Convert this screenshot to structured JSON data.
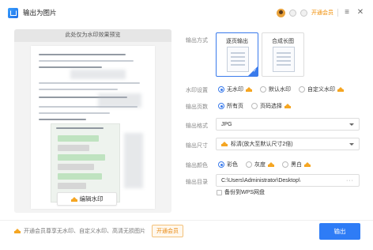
{
  "window": {
    "title": "输出为图片",
    "vip_link": "开通会员"
  },
  "preview": {
    "header": "此处仅为水印效果预览",
    "watermark_button": "编辑水印"
  },
  "settings": {
    "mode": {
      "label": "输出方式",
      "options": [
        "逐页输出",
        "合成长图"
      ],
      "selected": "逐页输出"
    },
    "watermark": {
      "label": "水印设置",
      "options": [
        "无水印",
        "默认水印",
        "自定义水印"
      ],
      "selected": "无水印"
    },
    "pages": {
      "label": "输出页数",
      "options": [
        "所有页",
        "页码选择"
      ],
      "selected": "所有页"
    },
    "format": {
      "label": "输出格式",
      "value": "JPG"
    },
    "size": {
      "label": "输出尺寸",
      "value": "标清(放大至默认尺寸2倍)"
    },
    "color": {
      "label": "输出颜色",
      "options": [
        "彩色",
        "灰度",
        "黑白"
      ],
      "selected": "彩色"
    },
    "directory": {
      "label": "输出目录",
      "value": "C:\\Users\\Administrator\\Desktop\\",
      "more": "···"
    },
    "backup": {
      "label": "备份到WPS网盘",
      "checked": false
    }
  },
  "footer": {
    "promo": "开通会员尊享无水印、自定义水印、高清无损图片",
    "vip_button": "开通会员",
    "export_button": "输出"
  },
  "colors": {
    "accent": "#2e7cf6",
    "vip": "#f08c00"
  }
}
